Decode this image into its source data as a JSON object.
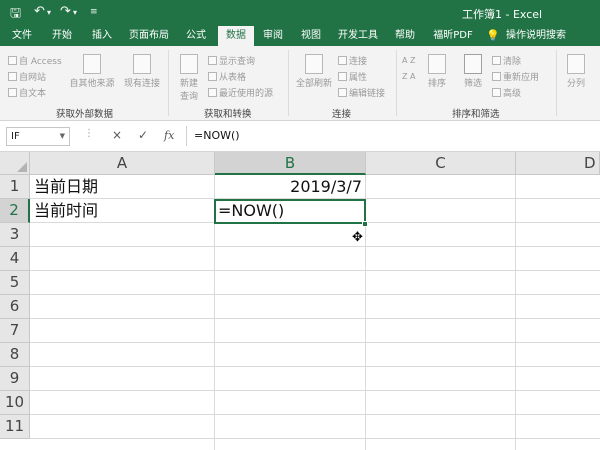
{
  "titlebar": {
    "save_icon": "save-icon",
    "undo_icon": "undo-icon",
    "redo_icon": "redo-icon",
    "customize_icon": "customize-icon",
    "title": "工作簿1 - Excel"
  },
  "menu": {
    "tabs": [
      "文件",
      "开始",
      "插入",
      "页面布局",
      "公式",
      "数据",
      "审阅",
      "视图",
      "开发工具",
      "帮助",
      "福昕PDF"
    ],
    "active_tab": "数据",
    "tell_me": "操作说明搜索",
    "tell_me_icon": "lightbulb-icon"
  },
  "ribbon": {
    "get_external": {
      "access": "自 Access",
      "web": "自网站",
      "text": "自文本",
      "other": "自其他来源",
      "existing": "现有连接",
      "label": "获取外部数据"
    },
    "get_transform": {
      "new_query": "新建",
      "new_query2": "查询",
      "show_queries": "显示查询",
      "from_table": "从表格",
      "recent_sources": "最近使用的源",
      "label": "获取和转换"
    },
    "connections": {
      "refresh_all": "全部刷新",
      "connections": "连接",
      "properties": "属性",
      "edit_links": "编辑链接",
      "label": "连接"
    },
    "sort_filter": {
      "sort_az_top": "A Z",
      "sort_az_bottom": "Z A",
      "sort": "排序",
      "filter": "筛选",
      "clear": "清除",
      "reapply": "重新应用",
      "advanced": "高级",
      "label": "排序和筛选"
    },
    "data_tools": {
      "split": "分列"
    }
  },
  "formula_bar": {
    "name_box": "IF",
    "cancel_icon": "×",
    "enter_icon": "✓",
    "fx_icon": "fx",
    "formula": "=NOW()"
  },
  "sheet": {
    "columns": [
      "A",
      "B",
      "C",
      "D"
    ],
    "selected_column": "B",
    "rows": [
      "1",
      "2",
      "3",
      "4",
      "5",
      "6",
      "7",
      "8",
      "9",
      "10",
      "11"
    ],
    "selected_row": "2",
    "cells": {
      "A1": "当前日期",
      "B1": "2019/3/7",
      "A2": "当前时间",
      "B2": "=NOW()"
    }
  }
}
